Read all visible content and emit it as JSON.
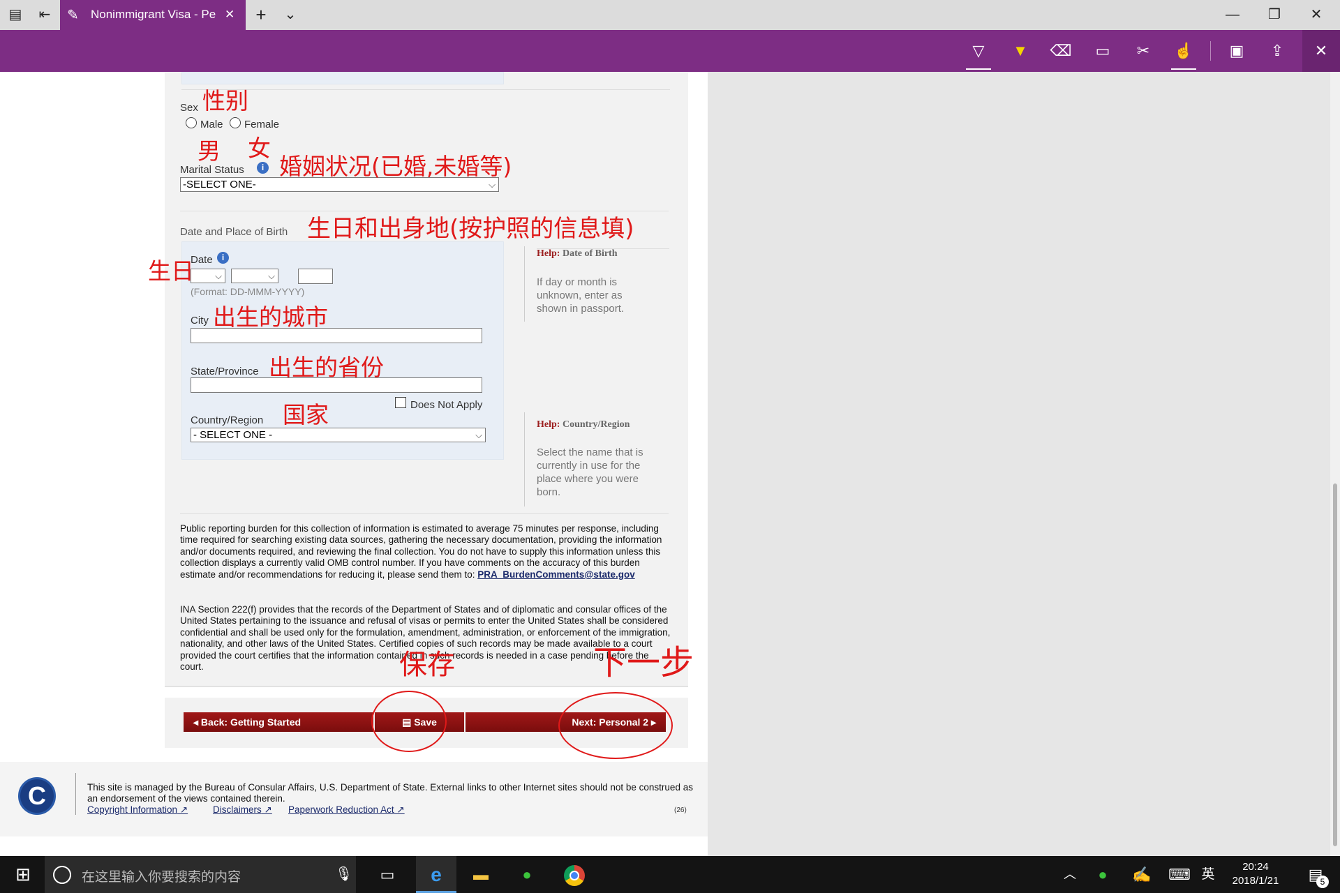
{
  "tab": {
    "title": "Nonimmigrant Visa - Pe",
    "close": "✕"
  },
  "window": {
    "min": "—",
    "max": "❐",
    "close": "✕"
  },
  "form": {
    "sex_label": "Sex",
    "sex_options": [
      "Male",
      "Female"
    ],
    "marital_label": "Marital Status",
    "marital_value": "-SELECT ONE-",
    "dob_section": "Date and Place of Birth",
    "date_label": "Date",
    "date_format": "(Format: DD-MMM-YYYY)",
    "city_label": "City",
    "state_label": "State/Province",
    "does_not_apply": "Does Not Apply",
    "country_label": "Country/Region",
    "country_value": "- SELECT ONE -"
  },
  "help": [
    {
      "prefix": "Help:",
      "title": "Date of Birth",
      "body": "If day or month is unknown, enter as shown in passport."
    },
    {
      "prefix": "Help:",
      "title": "Country/Region",
      "body": "Select the name that is currently in use for the place where you were born."
    }
  ],
  "burden": {
    "text": "Public reporting burden for this collection of information is estimated to average 75 minutes per response, including time required for searching existing data sources, gathering the necessary documentation, providing the information and/or documents required, and reviewing the final collection. You do not have to supply this information unless this collection displays a currently valid OMB control number. If you have comments on the accuracy of this burden estimate and/or recommendations for reducing it, please send them to:",
    "email": "PRA_BurdenComments@state.gov"
  },
  "ina": "INA Section 222(f) provides that the records of the Department of States and of diplomatic and consular offices of the United States pertaining to the issuance and refusal of visas or permits to enter the United States shall be considered confidential and shall be used only for the formulation, amendment, administration, or enforcement of the immigration, nationality, and other laws of the United States. Certified copies of such records may be made available to a court provided the court certifies that the information contained in such records is needed in a case pending before the court.",
  "nav": {
    "back": "Back: Getting Started",
    "save": "Save",
    "next": "Next: Personal 2"
  },
  "footer": {
    "text": "This site is managed by the Bureau of Consular Affairs, U.S. Department of State. External links to other Internet sites should not be construed as an endorsement of the views contained therein.",
    "links": [
      "Copyright Information",
      "Disclaimers",
      "Paperwork Reduction Act"
    ],
    "code": "(26)",
    "logo": "C"
  },
  "annotations": [
    "性别",
    "男",
    "女",
    "婚姻状况(已婚,未婚等)",
    "生日和出身地(按护照的信息填)",
    "生日",
    "出生的城市",
    "出生的省份",
    "国家",
    "保存",
    "下一步"
  ],
  "taskbar": {
    "search_placeholder": "在这里输入你要搜索的内容",
    "ime": "英",
    "time": "20:24",
    "date": "2018/1/21",
    "notif_count": "5"
  }
}
